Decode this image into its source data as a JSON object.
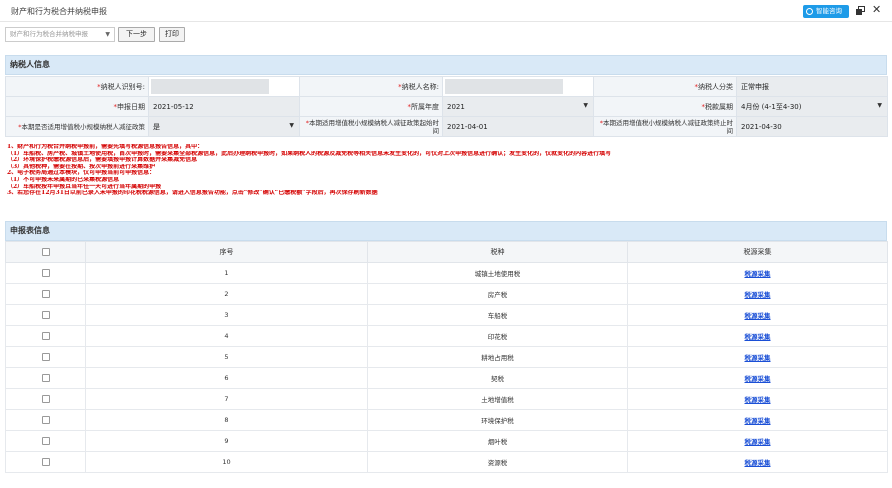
{
  "window": {
    "title": "财产和行为税合并纳税申报",
    "assist_label": "智能咨询"
  },
  "toolbar": {
    "select_value": "财产和行为税合并纳税申报",
    "next_label": "下一步",
    "print_label": "打印"
  },
  "taxpayer": {
    "section_title": "纳税人信息",
    "tax_id_label": "纳税人识别号:",
    "name_label": "纳税人名称:",
    "category_label": "纳税人分类",
    "category_value": "正常申报",
    "date_label": "申报日期",
    "date_value": "2021-05-12",
    "year_label": "所属年度",
    "year_value": "2021",
    "period_label": "税款属期",
    "period_value": "4月份 (4-1至4-30)",
    "small_q_label": "本期是否适用增值税小规模纳税人减征政策",
    "small_q_value": "是",
    "start_label": "本期适用增值税小规模纳税人减征政策起始时间",
    "start_value": "2021-04-01",
    "end_label": "本期适用增值税小规模纳税人减征政策终止时间",
    "end_value": "2021-04-30"
  },
  "notes": [
    "1、财产和行为税合并纳税申报前，需要先填写税源信息报告信息，其中：",
    "（1）车船税、房产税、城镇土地使用税，首次申报时，需要采集全部税源信息，此后办理纳税申报时，如果纳税人的税源及减免税等相关信息未发生变化的，可仅对上次申报信息进行确认；发生变化的，仅就变化的内容进行填写",
    "（2）环境保护税缴税源信息后，需要填报申报计算数据并采集减免信息",
    "（3）其他税种，需要在按期、按次申报前进行采集维护",
    "2、电子税务局通过本模块，仅可申报当前可申报信息：",
    "（1）不可申报未来属期的已采集税源信息",
    "（2）车船税按年申报且当年任一天可进行当年属期的申报",
    "3、若您存在12月31日以前已录入未申报的印花税税源信息，请进入信息报告功能，点击“修改”确认“已缴税额”字段后，再次保存刷新数据"
  ],
  "declaration": {
    "section_title": "申报表信息",
    "headers": {
      "seq": "序号",
      "tax": "税种",
      "action": "税源采集"
    },
    "rows": [
      {
        "seq": "1",
        "tax": "城镇土地使用税",
        "action": "税源采集"
      },
      {
        "seq": "2",
        "tax": "房产税",
        "action": "税源采集"
      },
      {
        "seq": "3",
        "tax": "车船税",
        "action": "税源采集"
      },
      {
        "seq": "4",
        "tax": "印花税",
        "action": "税源采集"
      },
      {
        "seq": "5",
        "tax": "耕地占用税",
        "action": "税源采集"
      },
      {
        "seq": "6",
        "tax": "契税",
        "action": "税源采集"
      },
      {
        "seq": "7",
        "tax": "土地增值税",
        "action": "税源采集"
      },
      {
        "seq": "8",
        "tax": "环境保护税",
        "action": "税源采集"
      },
      {
        "seq": "9",
        "tax": "烟叶税",
        "action": "税源采集"
      },
      {
        "seq": "10",
        "tax": "资源税",
        "action": "税源采集"
      }
    ]
  },
  "colors": {
    "header_blue": "#d9e9f7",
    "accent": "#1e9be8",
    "note_red": "#d40000",
    "link_blue": "#1a4fd6"
  }
}
